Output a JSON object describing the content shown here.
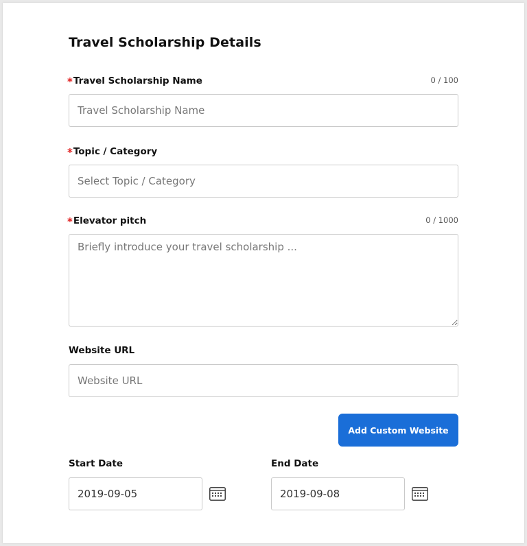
{
  "form": {
    "title": "Travel Scholarship Details",
    "required_marker": "*",
    "name": {
      "label": "Travel Scholarship Name",
      "counter": "0 / 100",
      "placeholder": "Travel Scholarship Name",
      "value": ""
    },
    "category": {
      "label": "Topic / Category",
      "placeholder": "Select Topic / Category",
      "value": ""
    },
    "pitch": {
      "label": "Elevator pitch",
      "counter": "0 / 1000",
      "placeholder": "Briefly introduce your travel scholarship ...",
      "value": ""
    },
    "website": {
      "label": "Website URL",
      "placeholder": "Website URL",
      "value": ""
    },
    "add_custom_website_label": "Add Custom Website",
    "start_date": {
      "label": "Start Date",
      "value": "2019-09-05",
      "icon": "calendar-icon"
    },
    "end_date": {
      "label": "End Date",
      "value": "2019-09-08",
      "icon": "calendar-icon"
    }
  },
  "colors": {
    "accent": "#1a6ed8",
    "required": "#e02020",
    "border": "#c9c9c9"
  }
}
